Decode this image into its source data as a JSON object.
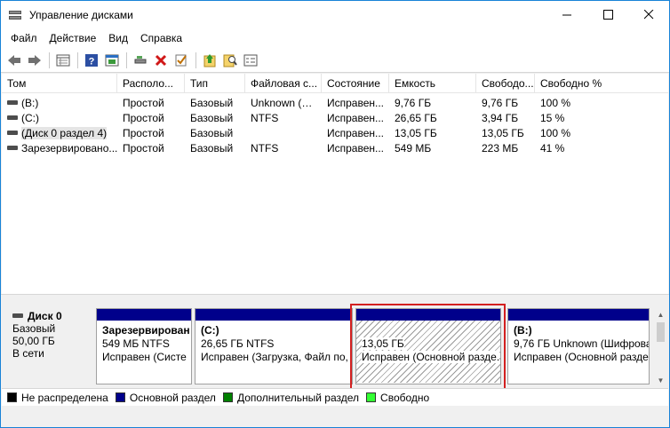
{
  "window": {
    "title": "Управление дисками"
  },
  "menu": [
    "Файл",
    "Действие",
    "Вид",
    "Справка"
  ],
  "toolbar": {
    "buttons": [
      "back-icon",
      "forward-icon",
      "sep",
      "list-view-icon",
      "sep",
      "help-icon",
      "properties-icon",
      "sep",
      "connect-icon",
      "delete-icon",
      "check-icon",
      "new-folder-icon",
      "search-icon",
      "settings-list-icon"
    ]
  },
  "columns": [
    "Том",
    "Располо...",
    "Тип",
    "Файловая с...",
    "Состояние",
    "Емкость",
    "Свободо...",
    "Свободно %"
  ],
  "volumes": [
    [
      "(B:)",
      "Простой",
      "Базовый",
      "Unknown (…",
      "Исправен...",
      "9,76 ГБ",
      "9,76 ГБ",
      "100 %"
    ],
    [
      "(C:)",
      "Простой",
      "Базовый",
      "NTFS",
      "Исправен...",
      "26,65 ГБ",
      "3,94 ГБ",
      "15 %"
    ],
    [
      "(Диск 0 раздел 4)",
      "Простой",
      "Базовый",
      "",
      "Исправен...",
      "13,05 ГБ",
      "13,05 ГБ",
      "100 %"
    ],
    [
      "Зарезервировано...",
      "Простой",
      "Базовый",
      "NTFS",
      "Исправен...",
      "549 МБ",
      "223 МБ",
      "41 %"
    ]
  ],
  "disk": {
    "name": "Диск 0",
    "type": "Базовый",
    "size": "50,00 ГБ",
    "status": "В сети"
  },
  "partitions": [
    {
      "name": "Зарезервирован",
      "size": "549 МБ NTFS",
      "status": "Исправен (Систе"
    },
    {
      "name": "(C:)",
      "size": "26,65 ГБ NTFS",
      "status": "Исправен (Загрузка, Файл по,"
    },
    {
      "name": "",
      "size": "13,05 ГБ",
      "status": "Исправен (Основной разде."
    },
    {
      "name": "(B:)",
      "size": "9,76 ГБ Unknown (Шифрова",
      "status": "Исправен (Основной разде"
    }
  ],
  "legend": [
    {
      "label": "Не распределена",
      "color": "#000000"
    },
    {
      "label": "Основной раздел",
      "color": "#00008b"
    },
    {
      "label": "Дополнительный раздел",
      "color": "#008000"
    },
    {
      "label": "Свободно",
      "color": "#33ff33"
    }
  ]
}
